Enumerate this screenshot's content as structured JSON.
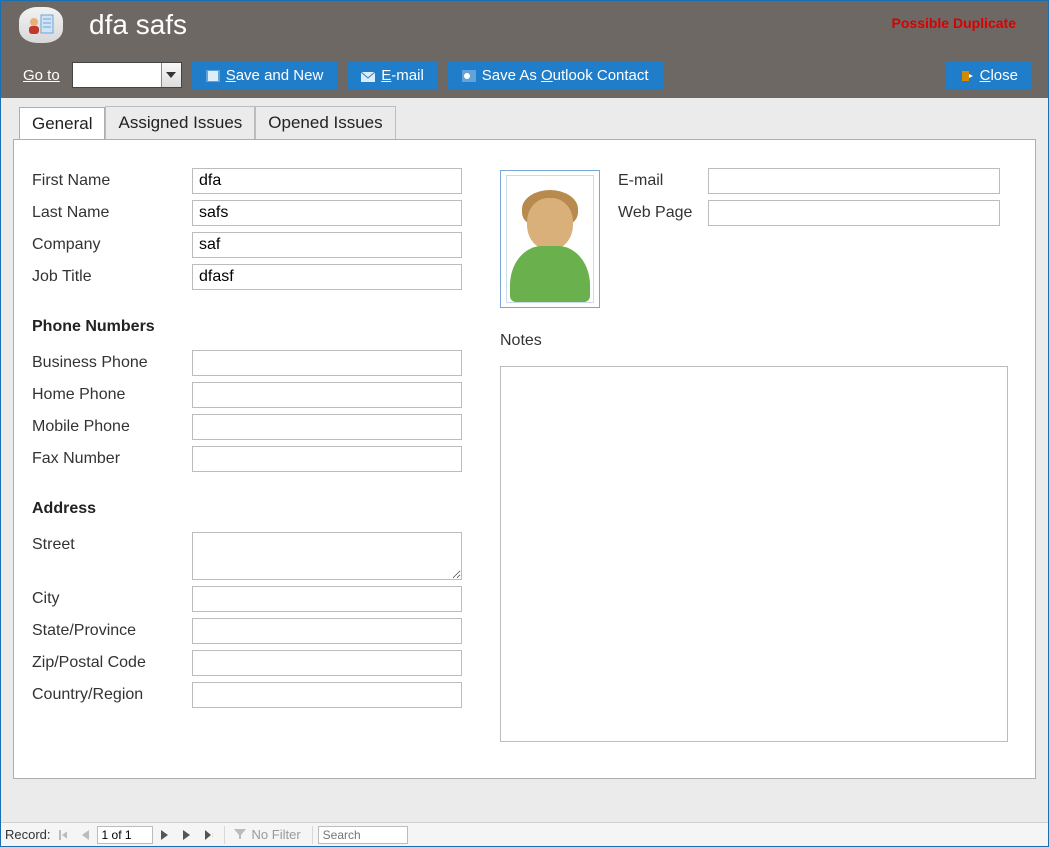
{
  "header": {
    "title": "dfa safs",
    "duplicate_warning": "Possible Duplicate",
    "goto_label": "Go to"
  },
  "toolbar": {
    "save_and_new": "Save and New",
    "email": "E-mail",
    "save_outlook": "Save As Outlook Contact",
    "close": "Close"
  },
  "tabs": {
    "general": "General",
    "assigned": "Assigned Issues",
    "opened": "Opened Issues",
    "active": "general"
  },
  "fields": {
    "first_name_label": "First Name",
    "first_name": "dfa",
    "last_name_label": "Last Name",
    "last_name": "safs",
    "company_label": "Company",
    "company": "saf",
    "job_title_label": "Job Title",
    "job_title": "dfasf",
    "email_label": "E-mail",
    "email": "",
    "web_label": "Web Page",
    "web": "",
    "notes_label": "Notes",
    "notes": ""
  },
  "sections": {
    "phone": "Phone Numbers",
    "address": "Address"
  },
  "phone": {
    "business_label": "Business Phone",
    "business": "",
    "home_label": "Home Phone",
    "home": "",
    "mobile_label": "Mobile Phone",
    "mobile": "",
    "fax_label": "Fax Number",
    "fax": ""
  },
  "address": {
    "street_label": "Street",
    "street": "",
    "city_label": "City",
    "city": "",
    "state_label": "State/Province",
    "state": "",
    "zip_label": "Zip/Postal Code",
    "zip": "",
    "country_label": "Country/Region",
    "country": ""
  },
  "footer": {
    "record_label": "Record:",
    "record_pos": "1 of 1",
    "no_filter": "No Filter",
    "search_placeholder": "Search"
  }
}
